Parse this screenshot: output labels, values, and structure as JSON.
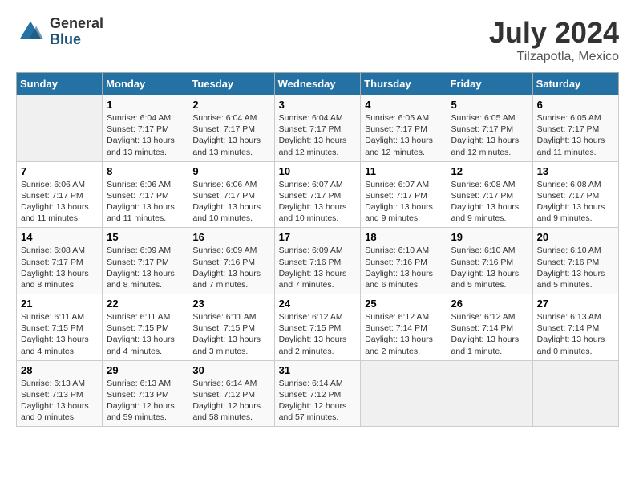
{
  "header": {
    "logo_general": "General",
    "logo_blue": "Blue",
    "month_title": "July 2024",
    "location": "Tilzapotla, Mexico"
  },
  "days_of_week": [
    "Sunday",
    "Monday",
    "Tuesday",
    "Wednesday",
    "Thursday",
    "Friday",
    "Saturday"
  ],
  "weeks": [
    [
      {
        "day": "",
        "info": ""
      },
      {
        "day": "1",
        "info": "Sunrise: 6:04 AM\nSunset: 7:17 PM\nDaylight: 13 hours\nand 13 minutes."
      },
      {
        "day": "2",
        "info": "Sunrise: 6:04 AM\nSunset: 7:17 PM\nDaylight: 13 hours\nand 13 minutes."
      },
      {
        "day": "3",
        "info": "Sunrise: 6:04 AM\nSunset: 7:17 PM\nDaylight: 13 hours\nand 12 minutes."
      },
      {
        "day": "4",
        "info": "Sunrise: 6:05 AM\nSunset: 7:17 PM\nDaylight: 13 hours\nand 12 minutes."
      },
      {
        "day": "5",
        "info": "Sunrise: 6:05 AM\nSunset: 7:17 PM\nDaylight: 13 hours\nand 12 minutes."
      },
      {
        "day": "6",
        "info": "Sunrise: 6:05 AM\nSunset: 7:17 PM\nDaylight: 13 hours\nand 11 minutes."
      }
    ],
    [
      {
        "day": "7",
        "info": "Sunrise: 6:06 AM\nSunset: 7:17 PM\nDaylight: 13 hours\nand 11 minutes."
      },
      {
        "day": "8",
        "info": "Sunrise: 6:06 AM\nSunset: 7:17 PM\nDaylight: 13 hours\nand 11 minutes."
      },
      {
        "day": "9",
        "info": "Sunrise: 6:06 AM\nSunset: 7:17 PM\nDaylight: 13 hours\nand 10 minutes."
      },
      {
        "day": "10",
        "info": "Sunrise: 6:07 AM\nSunset: 7:17 PM\nDaylight: 13 hours\nand 10 minutes."
      },
      {
        "day": "11",
        "info": "Sunrise: 6:07 AM\nSunset: 7:17 PM\nDaylight: 13 hours\nand 9 minutes."
      },
      {
        "day": "12",
        "info": "Sunrise: 6:08 AM\nSunset: 7:17 PM\nDaylight: 13 hours\nand 9 minutes."
      },
      {
        "day": "13",
        "info": "Sunrise: 6:08 AM\nSunset: 7:17 PM\nDaylight: 13 hours\nand 9 minutes."
      }
    ],
    [
      {
        "day": "14",
        "info": "Sunrise: 6:08 AM\nSunset: 7:17 PM\nDaylight: 13 hours\nand 8 minutes."
      },
      {
        "day": "15",
        "info": "Sunrise: 6:09 AM\nSunset: 7:17 PM\nDaylight: 13 hours\nand 8 minutes."
      },
      {
        "day": "16",
        "info": "Sunrise: 6:09 AM\nSunset: 7:16 PM\nDaylight: 13 hours\nand 7 minutes."
      },
      {
        "day": "17",
        "info": "Sunrise: 6:09 AM\nSunset: 7:16 PM\nDaylight: 13 hours\nand 7 minutes."
      },
      {
        "day": "18",
        "info": "Sunrise: 6:10 AM\nSunset: 7:16 PM\nDaylight: 13 hours\nand 6 minutes."
      },
      {
        "day": "19",
        "info": "Sunrise: 6:10 AM\nSunset: 7:16 PM\nDaylight: 13 hours\nand 5 minutes."
      },
      {
        "day": "20",
        "info": "Sunrise: 6:10 AM\nSunset: 7:16 PM\nDaylight: 13 hours\nand 5 minutes."
      }
    ],
    [
      {
        "day": "21",
        "info": "Sunrise: 6:11 AM\nSunset: 7:15 PM\nDaylight: 13 hours\nand 4 minutes."
      },
      {
        "day": "22",
        "info": "Sunrise: 6:11 AM\nSunset: 7:15 PM\nDaylight: 13 hours\nand 4 minutes."
      },
      {
        "day": "23",
        "info": "Sunrise: 6:11 AM\nSunset: 7:15 PM\nDaylight: 13 hours\nand 3 minutes."
      },
      {
        "day": "24",
        "info": "Sunrise: 6:12 AM\nSunset: 7:15 PM\nDaylight: 13 hours\nand 2 minutes."
      },
      {
        "day": "25",
        "info": "Sunrise: 6:12 AM\nSunset: 7:14 PM\nDaylight: 13 hours\nand 2 minutes."
      },
      {
        "day": "26",
        "info": "Sunrise: 6:12 AM\nSunset: 7:14 PM\nDaylight: 13 hours\nand 1 minute."
      },
      {
        "day": "27",
        "info": "Sunrise: 6:13 AM\nSunset: 7:14 PM\nDaylight: 13 hours\nand 0 minutes."
      }
    ],
    [
      {
        "day": "28",
        "info": "Sunrise: 6:13 AM\nSunset: 7:13 PM\nDaylight: 13 hours\nand 0 minutes."
      },
      {
        "day": "29",
        "info": "Sunrise: 6:13 AM\nSunset: 7:13 PM\nDaylight: 12 hours\nand 59 minutes."
      },
      {
        "day": "30",
        "info": "Sunrise: 6:14 AM\nSunset: 7:12 PM\nDaylight: 12 hours\nand 58 minutes."
      },
      {
        "day": "31",
        "info": "Sunrise: 6:14 AM\nSunset: 7:12 PM\nDaylight: 12 hours\nand 57 minutes."
      },
      {
        "day": "",
        "info": ""
      },
      {
        "day": "",
        "info": ""
      },
      {
        "day": "",
        "info": ""
      }
    ]
  ]
}
